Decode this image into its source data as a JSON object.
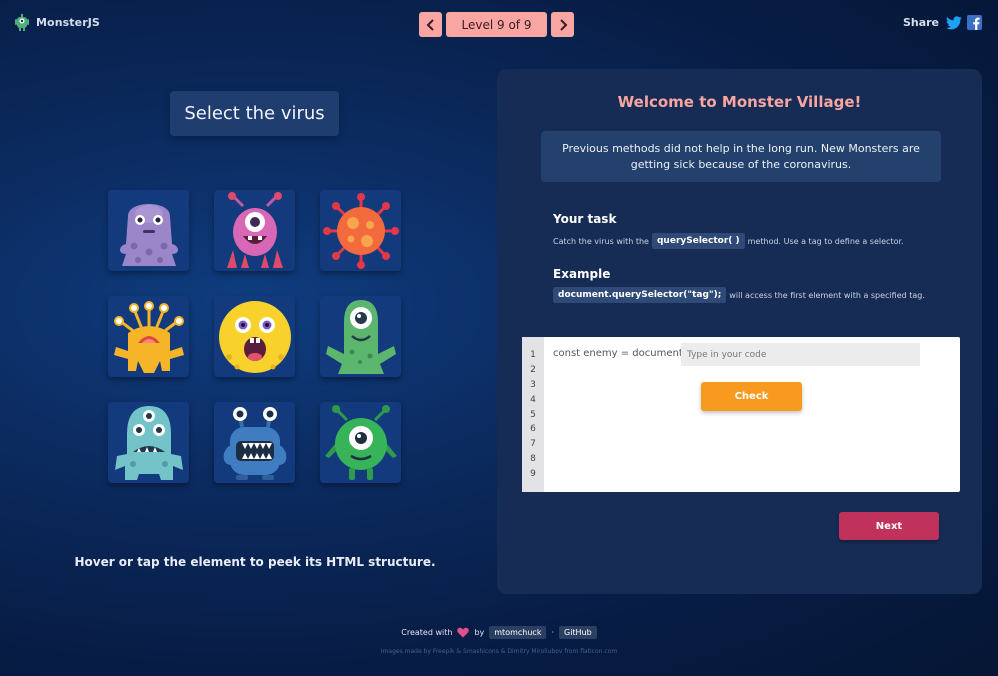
{
  "app": {
    "name": "MonsterJS"
  },
  "header": {
    "level_label": "Level 9 of 9",
    "share_label": "Share"
  },
  "game": {
    "instruction": "Select the virus",
    "hover_hint": "Hover or tap the element to peek its HTML structure.",
    "monsters": [
      "purple-blob-monster",
      "pink-cyclops-monster",
      "virus",
      "yellow-tentacle-monster",
      "yellow-round-monster",
      "green-cyclops-monster",
      "teal-three-eyed-monster",
      "blue-toothy-monster",
      "green-ball-monster"
    ]
  },
  "panel": {
    "title": "Welcome to Monster Village!",
    "story": "Previous methods did not help in the long run. New Monsters are getting sick because of the coronavirus.",
    "task_title": "Your task",
    "task_before": "Catch the virus with the",
    "task_code": "querySelector( )",
    "task_after": "method. Use a tag to define a selector.",
    "example_title": "Example",
    "example_code": "document.querySelector(\"tag\");",
    "example_after": "will access the first element with a specified tag."
  },
  "editor": {
    "line_numbers": [
      "1",
      "2",
      "3",
      "4",
      "5",
      "6",
      "7",
      "8",
      "9"
    ],
    "code_prefix": "const enemy = document.",
    "input_value": "",
    "input_placeholder": "Type in your code",
    "check_label": "Check"
  },
  "next_label": "Next",
  "footer": {
    "created_with": "Created with",
    "by": "by",
    "author": "mtomchuck",
    "separator": "·",
    "github": "GitHub",
    "credits": "Images made by Freepik & Smashicons & Dimitry Miroliubov from flaticon.com"
  },
  "colors": {
    "accent_pink": "#f9a5a1",
    "check_orange": "#f89a20",
    "next_magenta": "#c0325c",
    "panel_bg": "#172c55"
  }
}
